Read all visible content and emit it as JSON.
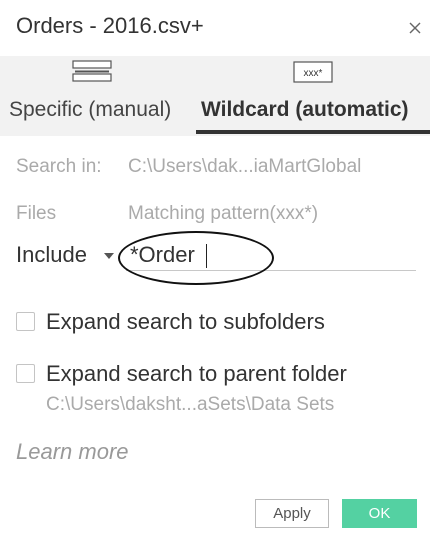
{
  "dialog": {
    "title": "Orders - 2016.csv+"
  },
  "mode_tabs": {
    "specific": {
      "label": "Specific (manual)",
      "icon": "list-icon"
    },
    "wildcard": {
      "label": "Wildcard (automatic)",
      "icon_text": "xxx*",
      "selected": true
    }
  },
  "search_in": {
    "label": "Search in:",
    "path": "C:\\Users\\dak...iaMartGlobal"
  },
  "files": {
    "label": "Files",
    "hint": "Matching pattern(xxx*)",
    "mode_selected": "Include",
    "pattern_value": "*Order"
  },
  "options": {
    "subfolders_label": "Expand search to subfolders",
    "subfolders_checked": false,
    "parent_label": "Expand search to parent folder",
    "parent_checked": false,
    "parent_path": "C:\\Users\\daksht...aSets\\Data Sets"
  },
  "learn_more": "Learn more",
  "buttons": {
    "apply": "Apply",
    "ok": "OK"
  },
  "colors": {
    "accent": "#54d1a2",
    "tab_bar_bg": "#f2f2f2",
    "muted_text": "#aaaaaa"
  }
}
